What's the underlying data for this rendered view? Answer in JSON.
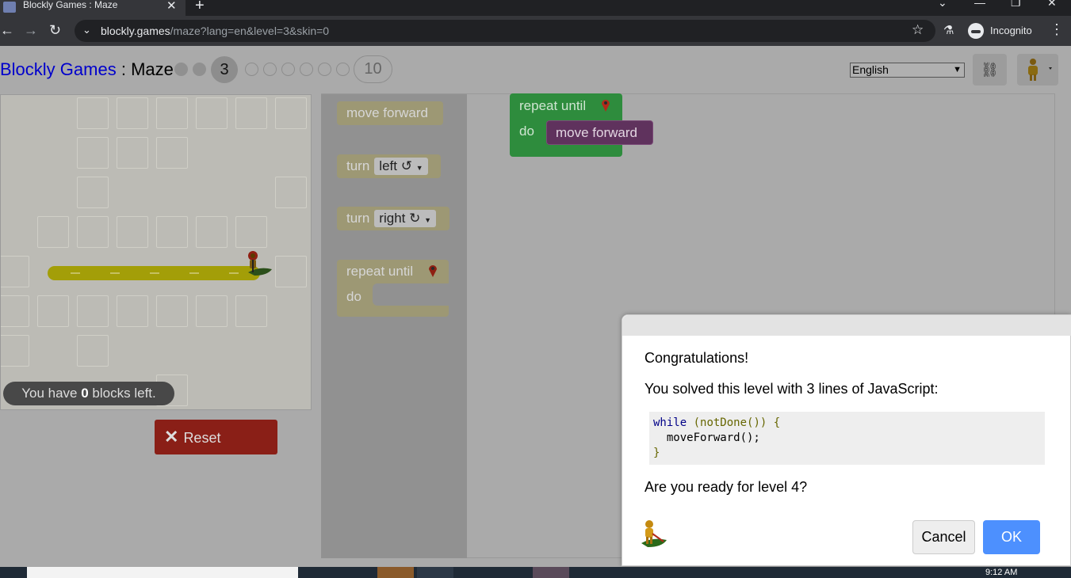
{
  "browser": {
    "tab_title": "Blockly Games : Maze",
    "url_host": "blockly.games",
    "url_path": "/maze?lang=en&level=3&skin=0",
    "profile_label": "Incognito"
  },
  "header": {
    "title_link": "Blockly Games",
    "title_sep": " : ",
    "title_page": "Maze",
    "current_level": "3",
    "last_level": "10",
    "language_selected": "English"
  },
  "maze": {
    "blocks_left_prefix": "You have ",
    "blocks_left_count": "0",
    "blocks_left_suffix": " blocks left.",
    "reset_label": "Reset"
  },
  "toolbox": {
    "move_forward": "move forward",
    "turn_label": "turn",
    "turn_left_option": "left ↺",
    "turn_right_option": "right ↻",
    "repeat_until": "repeat until",
    "do_label": "do"
  },
  "workspace": {
    "repeat_until": "repeat until",
    "do_label": "do",
    "move_forward": "move forward"
  },
  "dialog": {
    "congrats": "Congratulations!",
    "solved": "You solved this level with 3 lines of JavaScript:",
    "code_line1_kw": "while",
    "code_line1_rest": " (notDone()) {",
    "code_line2": "  moveForward();",
    "code_line3": "}",
    "ready": "Are you ready for level 4?",
    "cancel_label": "Cancel",
    "ok_label": "OK"
  },
  "taskbar": {
    "time": "9:12 AM"
  },
  "colors": {
    "ok_button": "#4d90fe",
    "reset_button": "#8a1f17",
    "repeat_block": "#2e8c3d",
    "move_block": "#5f325d"
  }
}
